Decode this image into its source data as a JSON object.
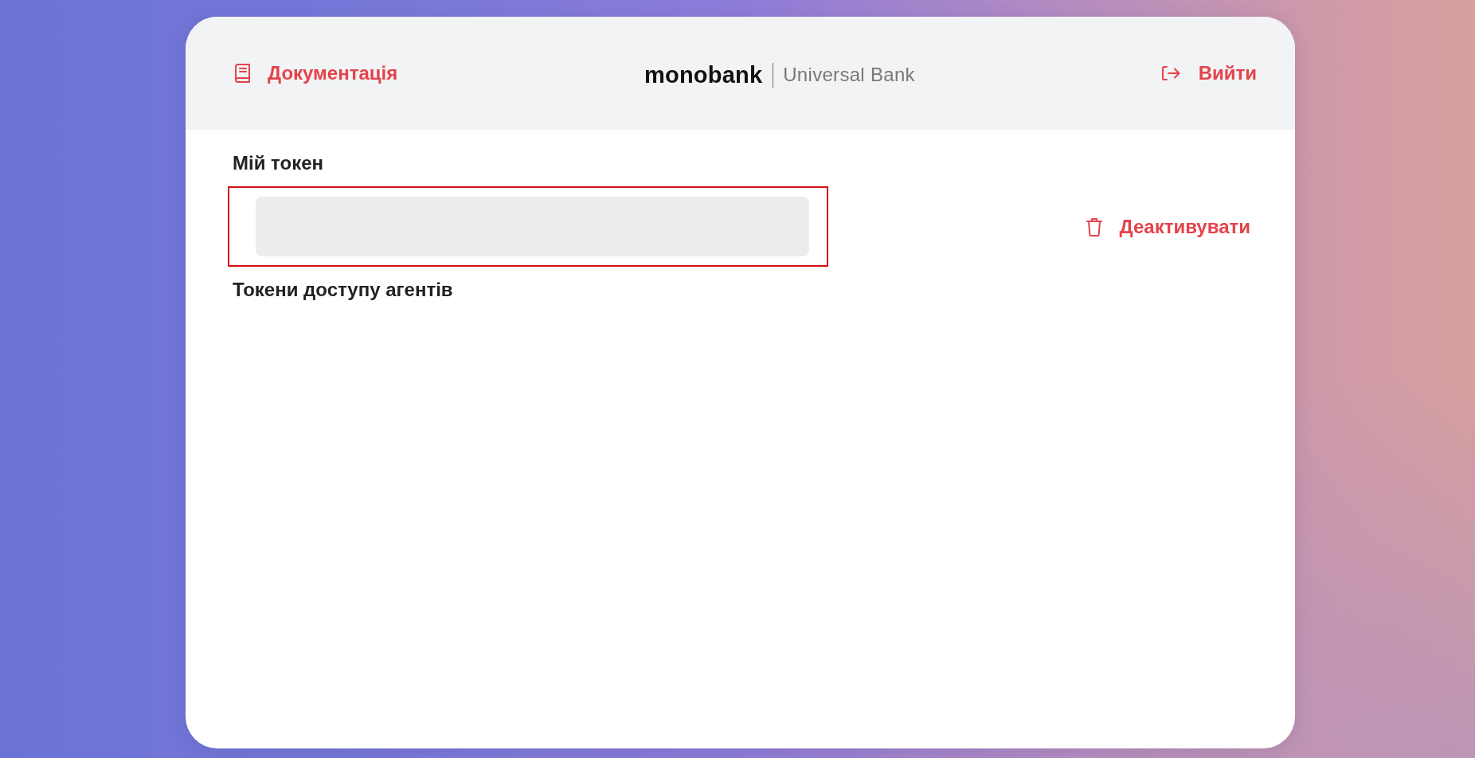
{
  "header": {
    "documentation_link": "Документація",
    "logo": {
      "brand": "monobank",
      "subtitle": "Universal Bank"
    },
    "logout_link": "Вийти"
  },
  "my_token": {
    "title": "Мій токен",
    "highlighted": true,
    "deactivate_button": "Деактивувати"
  },
  "agent_tokens": {
    "title": "Токени доступу агентів"
  }
}
